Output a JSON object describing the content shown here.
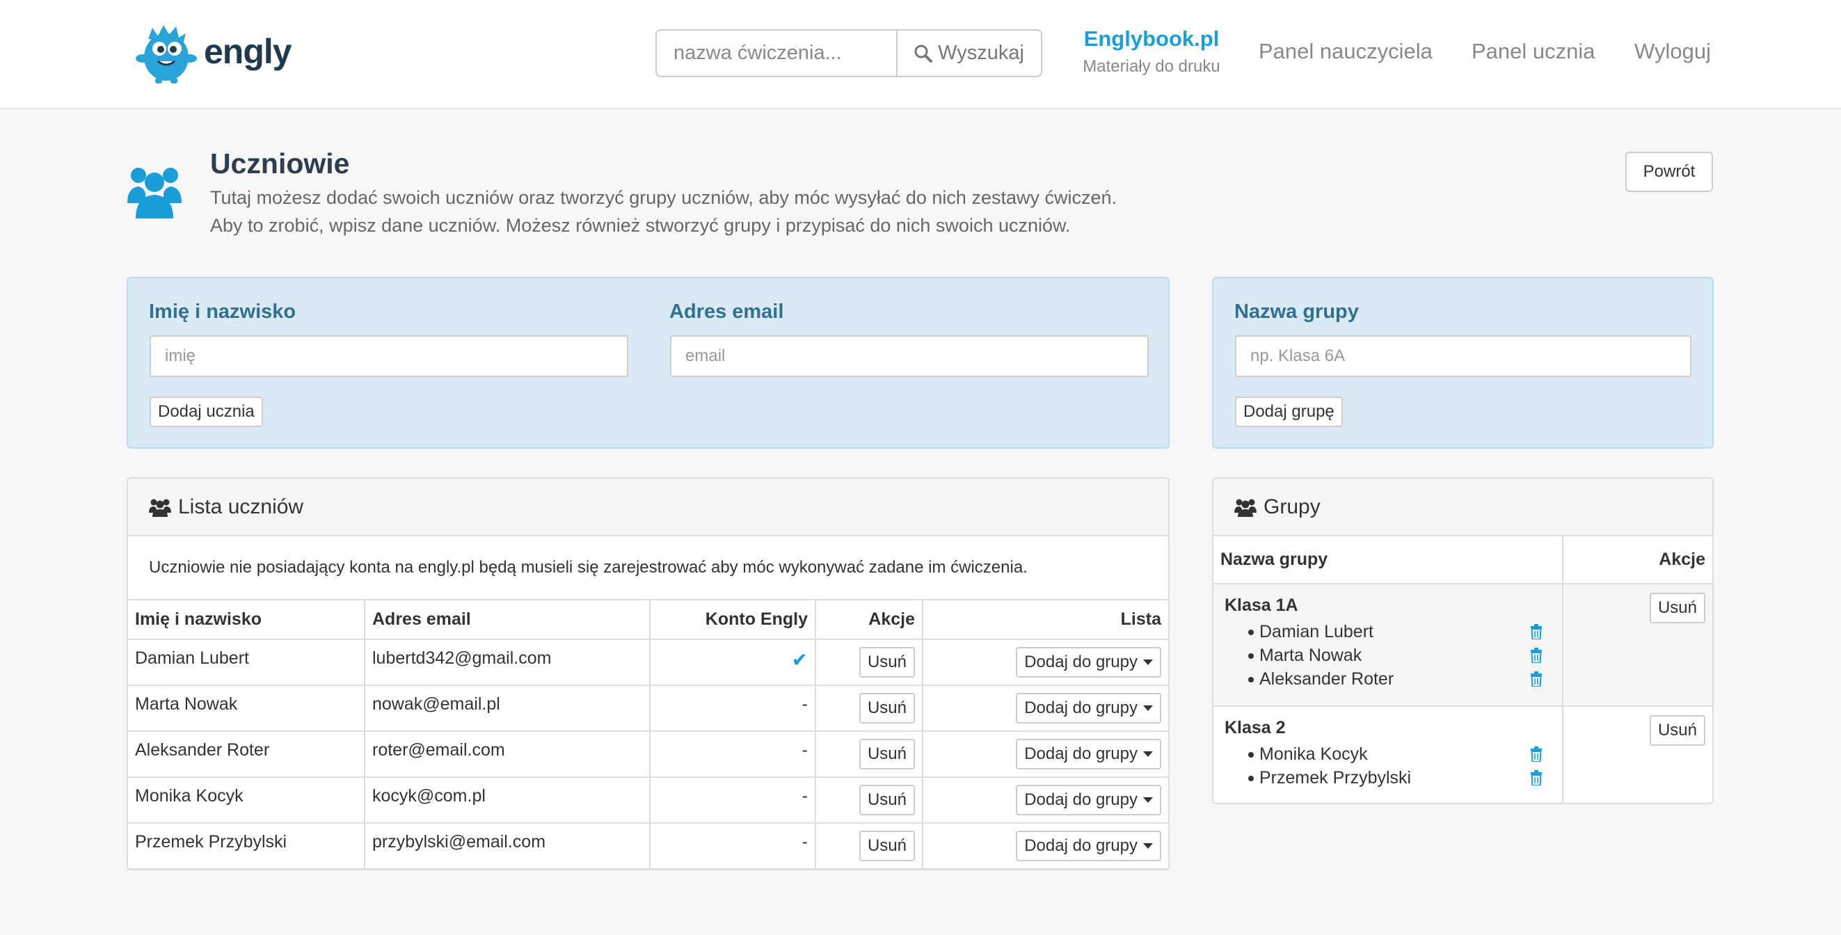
{
  "header": {
    "logo_text": "engly",
    "search_placeholder": "nazwa ćwiczenia...",
    "search_button": "Wyszukaj",
    "englybook_title": "Englybook.pl",
    "englybook_sub": "Materiały do druku",
    "nav": [
      "Panel nauczyciela",
      "Panel ucznia",
      "Wyloguj"
    ]
  },
  "page": {
    "title": "Uczniowie",
    "desc_line1": "Tutaj możesz dodać swoich uczniów oraz tworzyć grupy uczniów, aby móc wysyłać do nich zestawy ćwiczeń.",
    "desc_line2": "Aby to zrobić, wpisz dane uczniów. Możesz również stworzyć grupy i przypisać do nich swoich uczniów.",
    "back_button": "Powrót"
  },
  "student_form": {
    "name_label": "Imię i nazwisko",
    "name_placeholder": "imię",
    "email_label": "Adres email",
    "email_placeholder": "email",
    "add_button": "Dodaj ucznia"
  },
  "group_form": {
    "name_label": "Nazwa grupy",
    "name_placeholder": "np. Klasa 6A",
    "add_button": "Dodaj grupę"
  },
  "students_panel": {
    "title": "Lista uczniów",
    "note": "Uczniowie nie posiadający konta na engly.pl będą musieli się zarejestrować aby móc wykonywać zadane im ćwiczenia.",
    "columns": [
      "Imię i nazwisko",
      "Adres email",
      "Konto Engly",
      "Akcje",
      "Lista"
    ],
    "delete_label": "Usuń",
    "add_to_group_label": "Dodaj do grupy",
    "rows": [
      {
        "name": "Damian Lubert",
        "email": "lubertd342@gmail.com",
        "account": "✔"
      },
      {
        "name": "Marta Nowak",
        "email": "nowak@email.pl",
        "account": "-"
      },
      {
        "name": "Aleksander Roter",
        "email": "roter@email.com",
        "account": "-"
      },
      {
        "name": "Monika Kocyk",
        "email": "kocyk@com.pl",
        "account": "-"
      },
      {
        "name": "Przemek Przybylski",
        "email": "przybylski@email.com",
        "account": "-"
      }
    ]
  },
  "groups_panel": {
    "title": "Grupy",
    "columns": [
      "Nazwa grupy",
      "Akcje"
    ],
    "delete_label": "Usuń",
    "groups": [
      {
        "name": "Klasa 1A",
        "members": [
          "Damian Lubert",
          "Marta Nowak",
          "Aleksander Roter"
        ]
      },
      {
        "name": "Klasa 2",
        "members": [
          "Monika Kocyk",
          "Przemek Przybylski"
        ]
      }
    ]
  },
  "colors": {
    "accent": "#1a9ed8",
    "form_panel_bg": "#d9eaf4",
    "form_label": "#31708f"
  }
}
